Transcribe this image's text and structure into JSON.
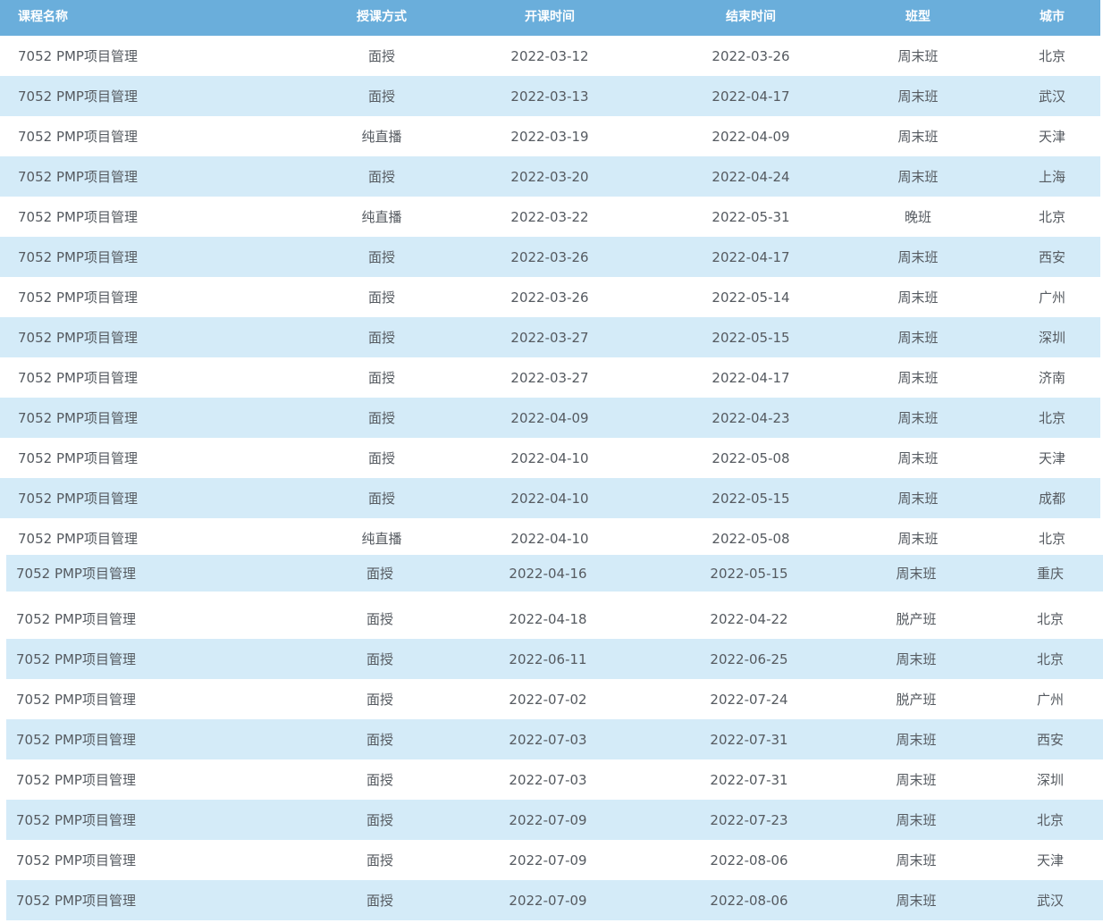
{
  "table": {
    "headers": {
      "name": "课程名称",
      "mode": "授课方式",
      "start": "开课时间",
      "end": "结束时间",
      "type": "班型",
      "city": "城市"
    },
    "rows": [
      {
        "name": "7052 PMP项目管理",
        "mode": "面授",
        "start": "2022-03-12",
        "end": "2022-03-26",
        "type": "周末班",
        "city": "北京"
      },
      {
        "name": "7052 PMP项目管理",
        "mode": "面授",
        "start": "2022-03-13",
        "end": "2022-04-17",
        "type": "周末班",
        "city": "武汉"
      },
      {
        "name": "7052 PMP项目管理",
        "mode": "纯直播",
        "start": "2022-03-19",
        "end": "2022-04-09",
        "type": "周末班",
        "city": "天津"
      },
      {
        "name": "7052 PMP项目管理",
        "mode": "面授",
        "start": "2022-03-20",
        "end": "2022-04-24",
        "type": "周末班",
        "city": "上海"
      },
      {
        "name": "7052 PMP项目管理",
        "mode": "纯直播",
        "start": "2022-03-22",
        "end": "2022-05-31",
        "type": "晚班",
        "city": "北京"
      },
      {
        "name": "7052 PMP项目管理",
        "mode": "面授",
        "start": "2022-03-26",
        "end": "2022-04-17",
        "type": "周末班",
        "city": "西安"
      },
      {
        "name": "7052 PMP项目管理",
        "mode": "面授",
        "start": "2022-03-26",
        "end": "2022-05-14",
        "type": "周末班",
        "city": "广州"
      },
      {
        "name": "7052 PMP项目管理",
        "mode": "面授",
        "start": "2022-03-27",
        "end": "2022-05-15",
        "type": "周末班",
        "city": "深圳"
      },
      {
        "name": "7052 PMP项目管理",
        "mode": "面授",
        "start": "2022-03-27",
        "end": "2022-04-17",
        "type": "周末班",
        "city": "济南"
      },
      {
        "name": "7052 PMP项目管理",
        "mode": "面授",
        "start": "2022-04-09",
        "end": "2022-04-23",
        "type": "周末班",
        "city": "北京"
      },
      {
        "name": "7052 PMP项目管理",
        "mode": "面授",
        "start": "2022-04-10",
        "end": "2022-05-08",
        "type": "周末班",
        "city": "天津"
      },
      {
        "name": "7052 PMP项目管理",
        "mode": "面授",
        "start": "2022-04-10",
        "end": "2022-05-15",
        "type": "周末班",
        "city": "成都"
      },
      {
        "name": "7052 PMP项目管理",
        "mode": "纯直播",
        "start": "2022-04-10",
        "end": "2022-05-08",
        "type": "周末班",
        "city": "北京"
      },
      {
        "name": "7052 PMP项目管理",
        "mode": "面授",
        "start": "2022-04-16",
        "end": "2022-05-15",
        "type": "周末班",
        "city": "重庆"
      },
      {
        "name": "7052 PMP项目管理",
        "mode": "面授",
        "start": "2022-04-18",
        "end": "2022-04-22",
        "type": "脱产班",
        "city": "北京"
      },
      {
        "name": "7052 PMP项目管理",
        "mode": "面授",
        "start": "2022-06-11",
        "end": "2022-06-25",
        "type": "周末班",
        "city": "北京"
      },
      {
        "name": "7052 PMP项目管理",
        "mode": "面授",
        "start": "2022-07-02",
        "end": "2022-07-24",
        "type": "脱产班",
        "city": "广州"
      },
      {
        "name": "7052 PMP项目管理",
        "mode": "面授",
        "start": "2022-07-03",
        "end": "2022-07-31",
        "type": "周末班",
        "city": "西安"
      },
      {
        "name": "7052 PMP项目管理",
        "mode": "面授",
        "start": "2022-07-03",
        "end": "2022-07-31",
        "type": "周末班",
        "city": "深圳"
      },
      {
        "name": "7052 PMP项目管理",
        "mode": "面授",
        "start": "2022-07-09",
        "end": "2022-07-23",
        "type": "周末班",
        "city": "北京"
      },
      {
        "name": "7052 PMP项目管理",
        "mode": "面授",
        "start": "2022-07-09",
        "end": "2022-08-06",
        "type": "周末班",
        "city": "天津"
      },
      {
        "name": "7052 PMP项目管理",
        "mode": "面授",
        "start": "2022-07-09",
        "end": "2022-08-06",
        "type": "周末班",
        "city": "武汉"
      }
    ]
  }
}
